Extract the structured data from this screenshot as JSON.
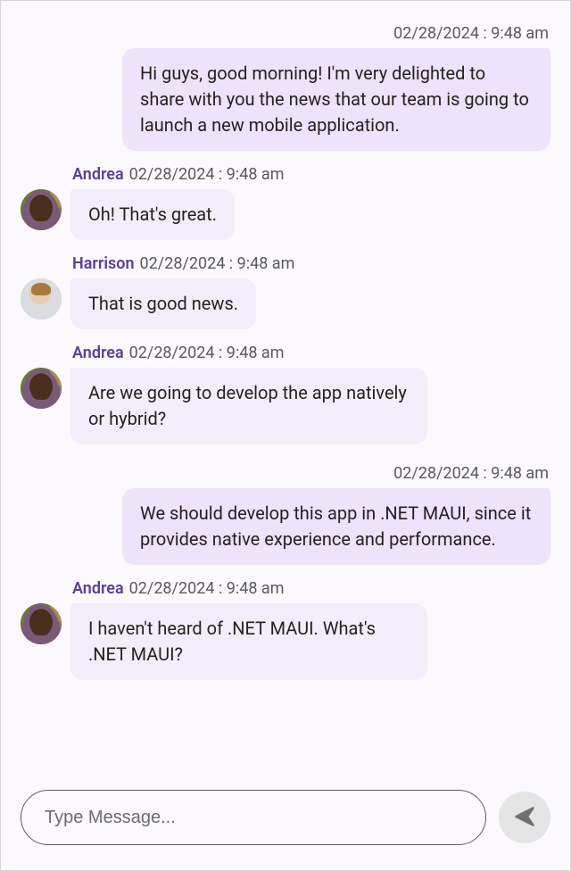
{
  "messages": [
    {
      "type": "out",
      "timestamp": "02/28/2024 : 9:48 am",
      "text": "Hi guys, good morning! I'm very delighted to share with you the news that our team is going to launch a new mobile application."
    },
    {
      "type": "in",
      "author": "Andrea",
      "avatar": "andrea",
      "timestamp": "02/28/2024 : 9:48 am",
      "text": "Oh! That's great."
    },
    {
      "type": "in",
      "author": "Harrison",
      "avatar": "harrison",
      "timestamp": "02/28/2024 : 9:48 am",
      "text": "That is good news."
    },
    {
      "type": "in",
      "author": "Andrea",
      "avatar": "andrea",
      "timestamp": "02/28/2024 : 9:48 am",
      "text": "Are we going to develop the app natively or hybrid?"
    },
    {
      "type": "out",
      "timestamp": "02/28/2024 : 9:48 am",
      "text": "We should develop this app in .NET MAUI, since it provides native experience and performance."
    },
    {
      "type": "in",
      "author": "Andrea",
      "avatar": "andrea",
      "timestamp": "02/28/2024 : 9:48 am",
      "text": "I haven't heard of .NET MAUI. What's .NET MAUI?"
    }
  ],
  "composer": {
    "placeholder": "Type Message...",
    "value": ""
  }
}
